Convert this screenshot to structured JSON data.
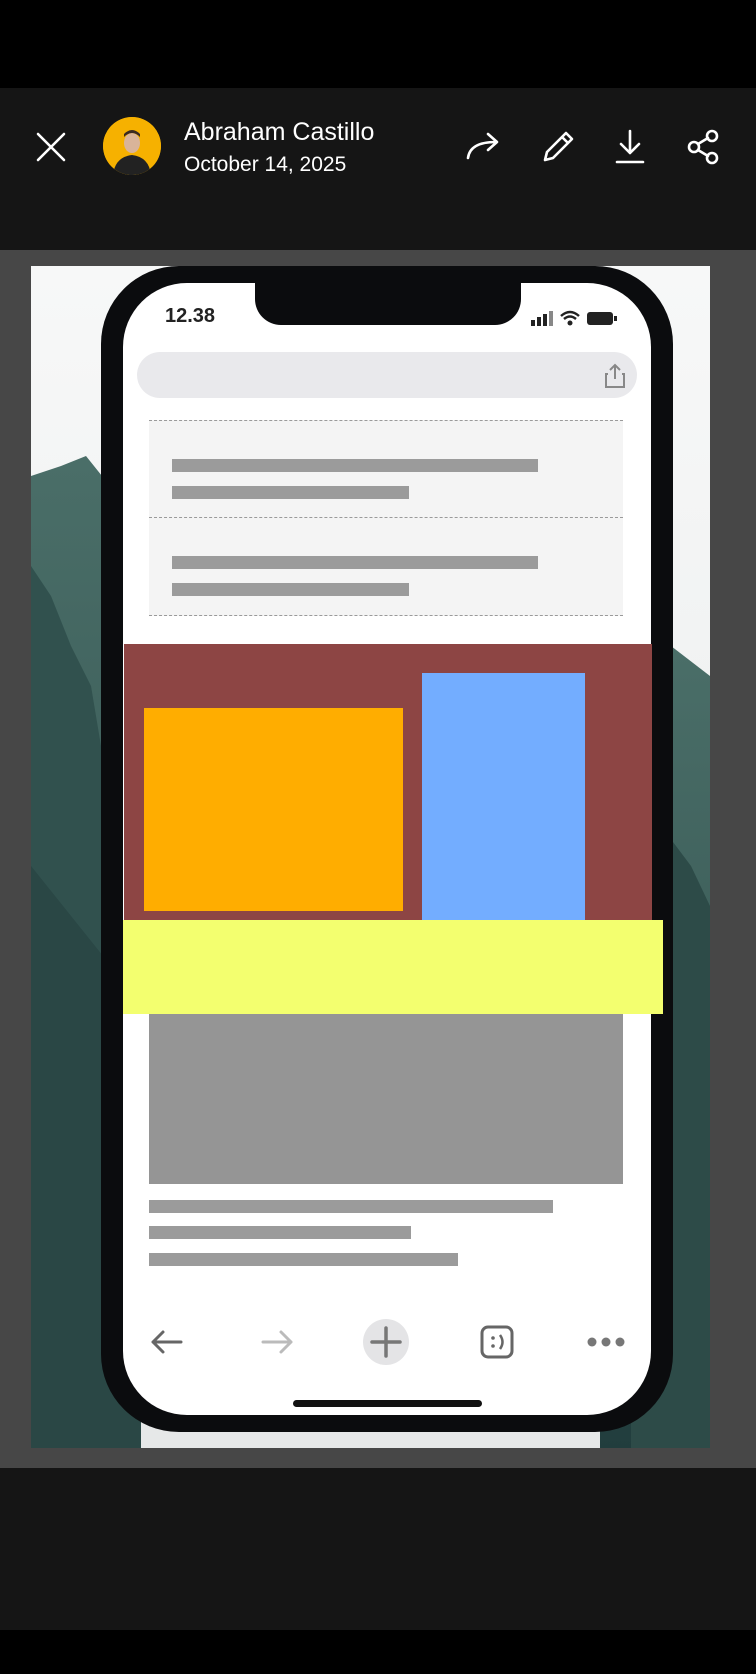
{
  "header": {
    "author_name": "Abraham Castillo",
    "date": "October 14, 2025",
    "icons": [
      "close-icon",
      "forward-icon",
      "edit-icon",
      "download-icon",
      "share-icon"
    ]
  },
  "photo": {
    "phone_time": "12.38",
    "colors": {
      "hero_red": "#8d4544",
      "orange": "#ffad00",
      "blue": "#73adff",
      "yellow": "#f3ff6f",
      "placeholder_gray": "#959595"
    },
    "toolbar_icons": [
      "back-icon",
      "forward-icon",
      "new-tab-icon",
      "tabs-icon",
      "more-icon"
    ]
  }
}
